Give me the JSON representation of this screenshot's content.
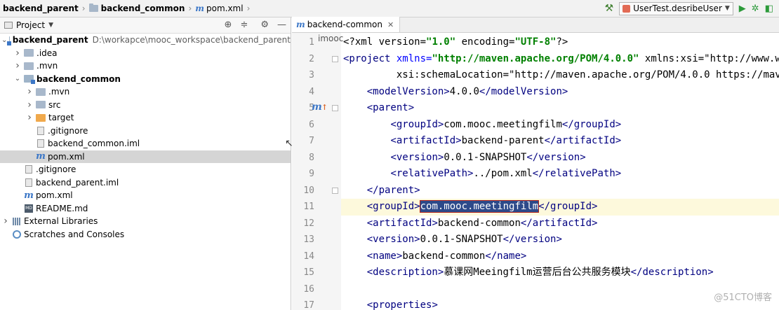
{
  "navbar": {
    "crumbs": [
      "backend_parent",
      "backend_common",
      "pom.xml"
    ],
    "run_config": "UserTest.desribeUser"
  },
  "project_panel": {
    "title": "Project",
    "tree": [
      {
        "label": "backend_parent",
        "path": "D:\\workapce\\mooc_workspace\\backend_parent",
        "indent": 0,
        "arrow": "v",
        "icon": "module-folder",
        "bold": true
      },
      {
        "label": ".idea",
        "indent": 1,
        "arrow": ">",
        "icon": "folder"
      },
      {
        "label": ".mvn",
        "indent": 1,
        "arrow": ">",
        "icon": "folder"
      },
      {
        "label": "backend_common",
        "indent": 1,
        "arrow": "v",
        "icon": "module-folder",
        "bold": true
      },
      {
        "label": ".mvn",
        "indent": 2,
        "arrow": ">",
        "icon": "folder"
      },
      {
        "label": "src",
        "indent": 2,
        "arrow": ">",
        "icon": "folder"
      },
      {
        "label": "target",
        "indent": 2,
        "arrow": ">",
        "icon": "orange-folder"
      },
      {
        "label": ".gitignore",
        "indent": 2,
        "arrow": "",
        "icon": "file"
      },
      {
        "label": "backend_common.iml",
        "indent": 2,
        "arrow": "",
        "icon": "file"
      },
      {
        "label": "pom.xml",
        "indent": 2,
        "arrow": "",
        "icon": "maven",
        "selected": true
      },
      {
        "label": ".gitignore",
        "indent": 1,
        "arrow": "",
        "icon": "file"
      },
      {
        "label": "backend_parent.iml",
        "indent": 1,
        "arrow": "",
        "icon": "file"
      },
      {
        "label": "pom.xml",
        "indent": 1,
        "arrow": "",
        "icon": "maven"
      },
      {
        "label": "README.md",
        "indent": 1,
        "arrow": "",
        "icon": "markdown"
      },
      {
        "label": "External Libraries",
        "indent": 0,
        "arrow": ">",
        "icon": "library"
      },
      {
        "label": "Scratches and Consoles",
        "indent": 0,
        "arrow": "",
        "icon": "scratch"
      }
    ]
  },
  "editor": {
    "tab_label": "backend-common",
    "gutter_label": "imooc",
    "lines": [
      {
        "n": "1",
        "text": "<?xml version=\"1.0\" encoding=\"UTF-8\"?>"
      },
      {
        "n": "2",
        "text": "<project xmlns=\"http://maven.apache.org/POM/4.0.0\" xmlns:xsi=\"http://www.w"
      },
      {
        "n": "3",
        "text": "         xsi:schemaLocation=\"http://maven.apache.org/POM/4.0.0 https://mav"
      },
      {
        "n": "4",
        "text": "    <modelVersion>4.0.0</modelVersion>"
      },
      {
        "n": "5",
        "text": "    <parent>"
      },
      {
        "n": "6",
        "text": "        <groupId>com.mooc.meetingfilm</groupId>"
      },
      {
        "n": "7",
        "text": "        <artifactId>backend-parent</artifactId>"
      },
      {
        "n": "8",
        "text": "        <version>0.0.1-SNAPSHOT</version>"
      },
      {
        "n": "9",
        "text": "        <relativePath>../pom.xml</relativePath>"
      },
      {
        "n": "10",
        "text": "    </parent>"
      },
      {
        "n": "11",
        "text": "    <groupId>com.mooc.meetingfilm</groupId>"
      },
      {
        "n": "12",
        "text": "    <artifactId>backend-common</artifactId>"
      },
      {
        "n": "13",
        "text": "    <version>0.0.1-SNAPSHOT</version>"
      },
      {
        "n": "14",
        "text": "    <name>backend-common</name>"
      },
      {
        "n": "15",
        "text": "    <description>慕课网Meeingfilm运营后台公共服务模块</description>"
      },
      {
        "n": "16",
        "text": ""
      },
      {
        "n": "17",
        "text": "    <properties>"
      }
    ],
    "current_line": "11",
    "selection": "com.mooc.meetingfilm"
  },
  "watermark": "@51CTO博客"
}
